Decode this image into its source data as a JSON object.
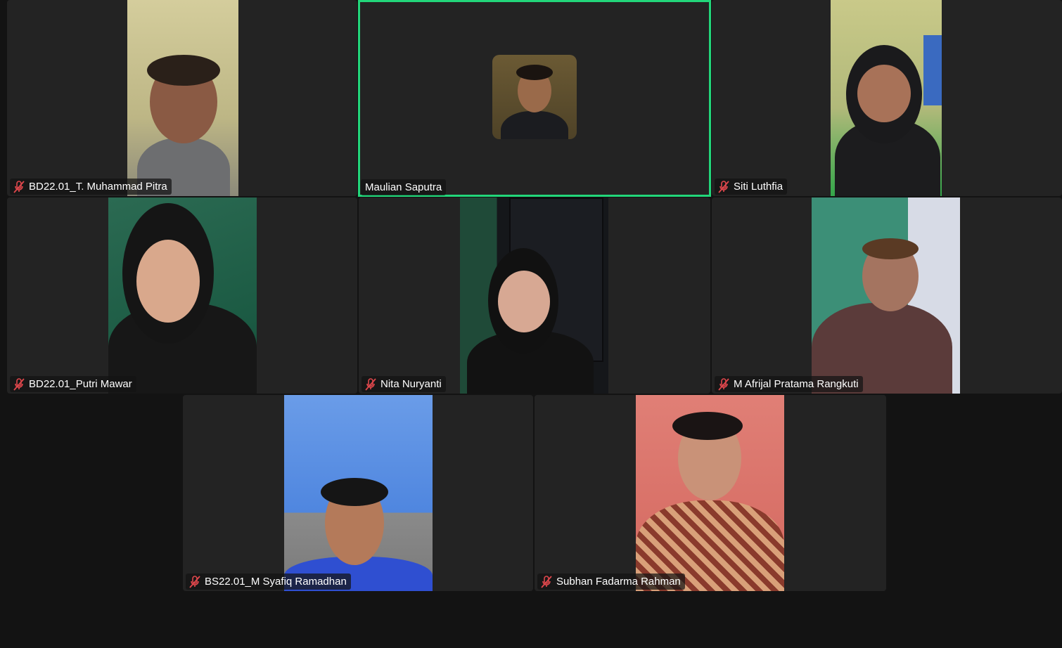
{
  "meeting": {
    "active_speaker_color": "#22d67a",
    "muted_icon_color": "#e0474c",
    "participants": [
      {
        "name": "BD22.01_T. Muhammad Pitra",
        "muted": true,
        "video": true,
        "bg": "#c9c08e"
      },
      {
        "name": "Maulian Saputra",
        "muted": false,
        "video": false,
        "active_speaker": true,
        "bg": "#5b4a2c"
      },
      {
        "name": "Siti Luthfia",
        "muted": true,
        "video": true,
        "bg": "#b9c27a"
      },
      {
        "name": "BD22.01_Putri Mawar",
        "muted": true,
        "video": true,
        "bg": "#1f5a44"
      },
      {
        "name": "Nita Nuryanti",
        "muted": true,
        "video": true,
        "bg": "#1a3f30"
      },
      {
        "name": "M Afrijal Pratama Rangkuti",
        "muted": true,
        "video": true,
        "bg": "#3f8d76"
      },
      {
        "name": "BS22.01_M Syafiq Ramadhan",
        "muted": true,
        "video": true,
        "bg": "#5b8fe0"
      },
      {
        "name": "Subhan Fadarma Rahman",
        "muted": true,
        "video": true,
        "bg": "#d9776f"
      }
    ]
  }
}
